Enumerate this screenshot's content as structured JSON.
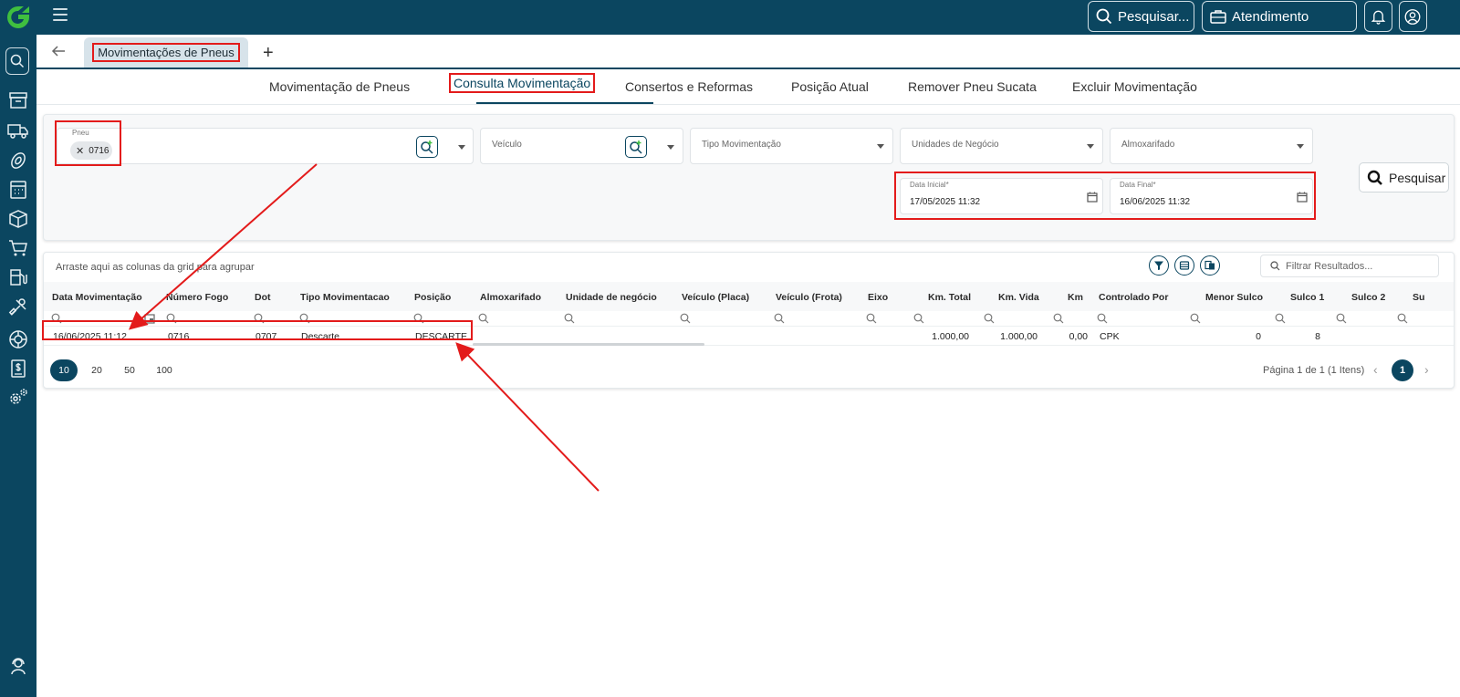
{
  "topbar": {
    "search_label": "Pesquisar...",
    "attendance_label": "Atendimento"
  },
  "tabs": {
    "active_page": "Movimentações de Pneus",
    "add_tab": "+"
  },
  "subnav": {
    "items": [
      "Movimentação de Pneus",
      "Consulta Movimentação",
      "Consertos e Reformas",
      "Posição Atual",
      "Remover Pneu Sucata",
      "Excluir Movimentação"
    ],
    "active_index": 1
  },
  "filters": {
    "pneu_label": "Pneu",
    "pneu_value": "0716",
    "veiculo_label": "Veículo",
    "tipo_label": "Tipo Movimentação",
    "unidades_label": "Unidades de Negócio",
    "almox_label": "Almoxarifado",
    "data_inicial_label": "Data Inicial*",
    "data_inicial_value": "17/05/2025 11:32",
    "data_final_label": "Data Final*",
    "data_final_value": "16/06/2025 11:32",
    "search_button": "Pesquisar"
  },
  "grid": {
    "group_hint": "Arraste aqui as colunas da grid para agrupar",
    "filter_placeholder": "Filtrar Resultados...",
    "columns": [
      "Data Movimentação",
      "Número Fogo",
      "Dot",
      "Tipo Movimentacao",
      "Posição",
      "Almoxarifado",
      "Unidade de negócio",
      "Veículo (Placa)",
      "Veículo (Frota)",
      "Eixo",
      "Km. Total",
      "Km. Vida",
      "Km",
      "Controlado Por",
      "Menor Sulco",
      "Sulco 1",
      "Sulco 2",
      "Su"
    ],
    "row": {
      "data": "16/06/2025 11:12",
      "numero_fogo": "0716",
      "dot": "0707",
      "tipo": "Descarte",
      "posicao": "DESCARTE",
      "km_total": "1.000,00",
      "km_vida": "1.000,00",
      "km": "0,00",
      "controlado_por": "CPK",
      "menor_sulco": "0",
      "sulco1": "8"
    },
    "page_sizes": [
      "10",
      "20",
      "50",
      "100"
    ],
    "page_info": "Página 1 de 1 (1 Itens)",
    "current_page": "1"
  },
  "colors": {
    "brand": "#0b4660",
    "annotation": "#e31b1b",
    "logo": "#3fbf3f"
  }
}
